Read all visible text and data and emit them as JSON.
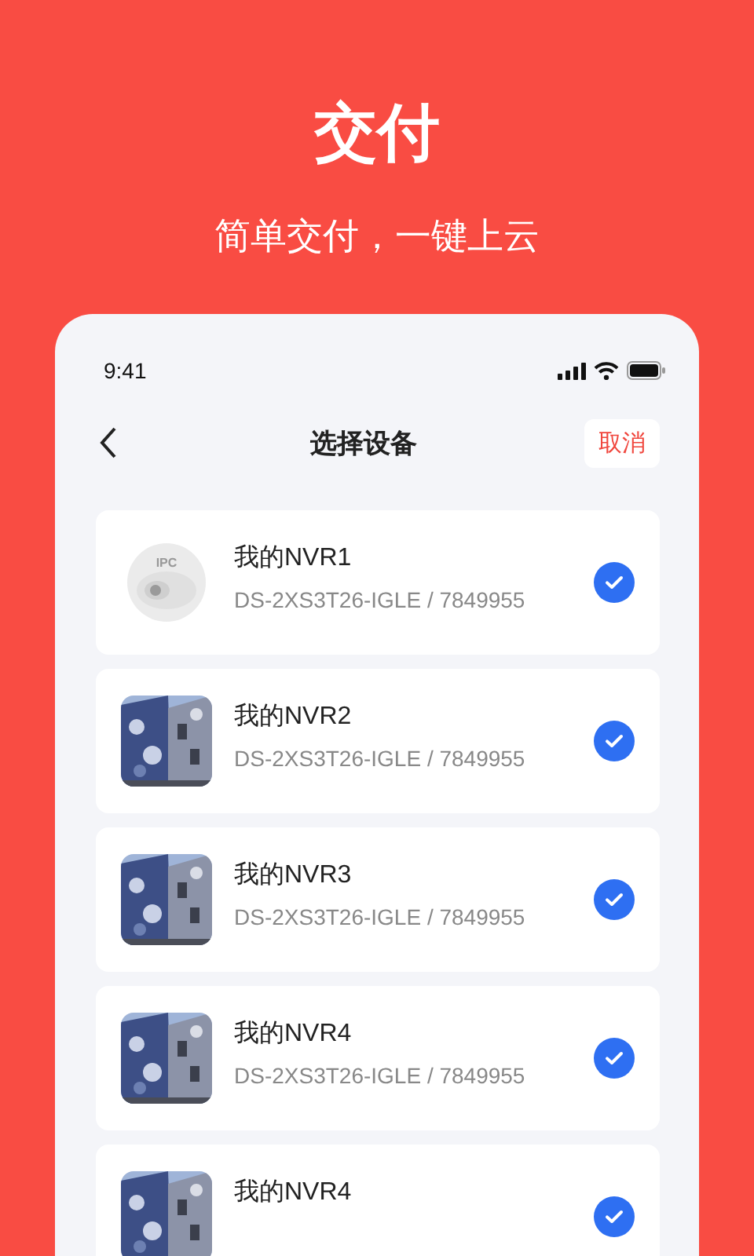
{
  "hero": {
    "title": "交付",
    "subtitle": "简单交付，一键上云"
  },
  "status_bar": {
    "time": "9:41"
  },
  "nav": {
    "title": "选择设备",
    "cancel": "取消"
  },
  "devices": [
    {
      "name": "我的NVR1",
      "detail": "DS-2XS3T26-IGLE / 7849955",
      "thumb": {
        "kind": "ipc",
        "label": "IPC"
      },
      "checked": true
    },
    {
      "name": "我的NVR2",
      "detail": "DS-2XS3T26-IGLE / 7849955",
      "checked": true
    },
    {
      "name": "我的NVR3",
      "detail": "DS-2XS3T26-IGLE / 7849955",
      "checked": true
    },
    {
      "name": "我的NVR4",
      "detail": "DS-2XS3T26-IGLE / 7849955",
      "checked": true
    },
    {
      "name": "我的NVR4",
      "checked": true
    }
  ]
}
